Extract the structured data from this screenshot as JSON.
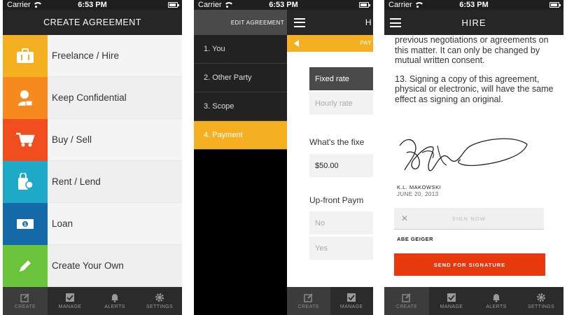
{
  "status": {
    "carrier": "Carrier",
    "time": "6:53 PM"
  },
  "screen1": {
    "title": "CREATE AGREEMENT",
    "categories": [
      {
        "label": "Freelance / Hire",
        "icon": "briefcase-icon",
        "color": "#f5b021"
      },
      {
        "label": "Keep Confidential",
        "icon": "person-lock-icon",
        "color": "#f68a1e"
      },
      {
        "label": "Buy / Sell",
        "icon": "cart-icon",
        "color": "#f04e1e"
      },
      {
        "label": "Rent / Lend",
        "icon": "bag-dollar-icon",
        "color": "#1ea9c7"
      },
      {
        "label": "Loan",
        "icon": "money-bill-icon",
        "color": "#1469a8"
      },
      {
        "label": "Create Your Own",
        "icon": "pencil-icon",
        "color": "#6cc33c"
      }
    ]
  },
  "tabs": [
    {
      "label": "CREATE",
      "icon": "compose-icon"
    },
    {
      "label": "MANAGE",
      "icon": "checkbox-icon"
    },
    {
      "label": "ALERTS",
      "icon": "bell-icon"
    },
    {
      "label": "SETTINGS",
      "icon": "gear-icon"
    }
  ],
  "screen2": {
    "menu_title": "EDIT AGREEMENT",
    "steps": [
      "1. You",
      "2. Other Party",
      "3. Scope",
      "4. Payment"
    ],
    "header_fragment": "H",
    "payment_fragment": "PAY",
    "rate_options": [
      "Fixed rate",
      "Hourly rate"
    ],
    "question1": "What's the fixe",
    "amount": "$50.00",
    "question2": "Up-front Paym",
    "upfront_options": [
      "No",
      "Yes"
    ],
    "tabs_visible": [
      "CREATE",
      "MANAGE"
    ]
  },
  "screen3": {
    "title": "HIRE",
    "paragraph1": "previous negotiations or agreements on this matter. It can only be changed by mutual written consent.",
    "paragraph2": "13. Signing a copy of this agreement, physical or electronic, will have the same effect as signing an original.",
    "signer1_name": "K.L. MAKOWSKI",
    "signer1_date": "JUNE 20, 2013",
    "sign_now": "SIGN NOW",
    "signer2_name": "ABE GEIGER",
    "send_button": "SEND FOR SIGNATURE",
    "accent": "#e8380d"
  }
}
